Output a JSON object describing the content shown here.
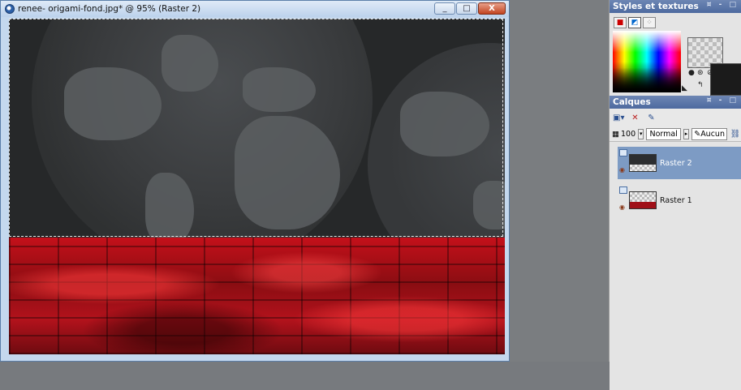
{
  "document": {
    "title": "renee- origami-fond.jpg* @  95% (Raster 2)",
    "buttons": {
      "minimize": "_",
      "maximize": "□",
      "close": "X"
    }
  },
  "styles_panel": {
    "title": "Styles et textures",
    "controls": "¤ - □"
  },
  "layers_panel": {
    "title": "Calques",
    "controls": "¤ - □",
    "opacity": "100",
    "blend_mode": "Normal",
    "mask": "Aucun",
    "layers": [
      {
        "name": "Raster 2",
        "selected": true
      },
      {
        "name": "Raster 1",
        "selected": false
      }
    ]
  },
  "colors": {
    "title_gradient_top": "#dfeaf7",
    "panel_title": "#5a76a8",
    "selected_layer": "#7d9bc4",
    "floor_red": "#c4101a"
  }
}
